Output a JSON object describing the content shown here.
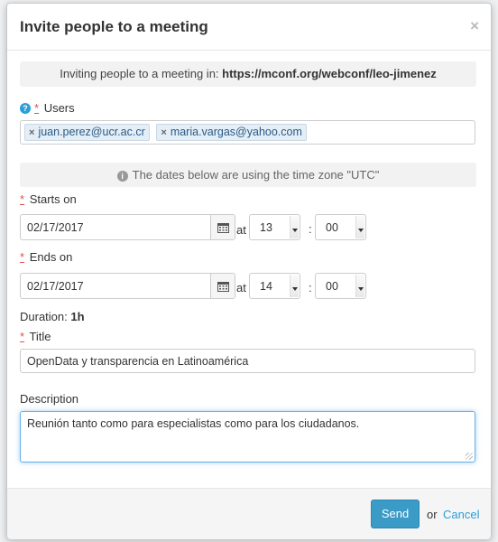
{
  "modal": {
    "title": "Invite people to a meeting",
    "close": "×"
  },
  "invite_info": {
    "prefix": "Inviting people to a meeting in: ",
    "url": "https://mconf.org/webconf/leo-jimenez"
  },
  "users": {
    "label": "Users",
    "tags": [
      "juan.perez@ucr.ac.cr",
      "maria.vargas@yahoo.com"
    ]
  },
  "timezone_note": "The dates below are using the time zone \"UTC\"",
  "starts": {
    "label": "Starts on",
    "date": "02/17/2017",
    "at": "at",
    "hour": "13",
    "minute": "00"
  },
  "ends": {
    "label": "Ends on",
    "date": "02/17/2017",
    "at": "at",
    "hour": "14",
    "minute": "00"
  },
  "duration": {
    "label": "Duration:",
    "value": "1h"
  },
  "title_field": {
    "label": "Title",
    "value": "OpenData y transparencia en Latinoamérica"
  },
  "description": {
    "label": "Description",
    "value": "Reunión tanto como para especialistas como para los ciudadanos."
  },
  "footer": {
    "send": "Send",
    "or": "or",
    "cancel": "Cancel"
  },
  "required_marker": "*",
  "colors": {
    "primary": "#3a9bc7",
    "link": "#2a9fd6",
    "required": "#d9534f"
  }
}
